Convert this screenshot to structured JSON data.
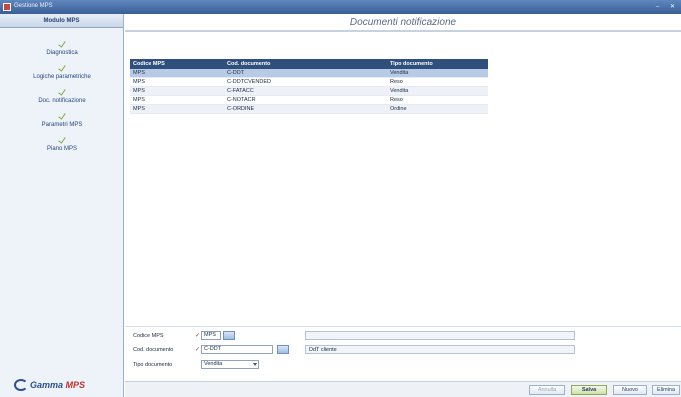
{
  "window": {
    "title": "Gestione MPS",
    "min": "–",
    "close": "✕"
  },
  "sidebar": {
    "header": "Modulo MPS",
    "items": [
      {
        "label": "Diagnostica"
      },
      {
        "label": "Logiche parametriche"
      },
      {
        "label": "Doc. notificazione"
      },
      {
        "label": "Parametri MPS"
      },
      {
        "label": "Piano MPS"
      }
    ],
    "logo": {
      "part1": "Gamma",
      "part2": "MPS"
    }
  },
  "page": {
    "title": "Documenti notificazione"
  },
  "grid": {
    "columns": [
      "Codice MPS",
      "Cod. documento",
      "Tipo documento"
    ],
    "rows": [
      [
        "MPS",
        "C-DDT",
        "Vendita"
      ],
      [
        "MPS",
        "C-DDTCVENDED",
        "Reso"
      ],
      [
        "MPS",
        "C-FATACC",
        "Vendita"
      ],
      [
        "MPS",
        "C-NOTACR",
        "Reso"
      ],
      [
        "MPS",
        "C-ORDINE",
        "Ordine"
      ]
    ]
  },
  "form": {
    "codice_mps_label": "Codice MPS",
    "codice_mps_value": "MPS",
    "cod_documento_label": "Cod. documento",
    "cod_documento_value": "C-DDT",
    "cod_documento_desc": "DdT cliente",
    "tipo_documento_label": "Tipo documento",
    "tipo_documento_value": "Vendita"
  },
  "buttons": {
    "annulla": "Annulla",
    "salva": "Salva",
    "nuovo": "Nuovo",
    "elimina": "Elimina"
  },
  "colors": {
    "grid_header": "#2f4f7d",
    "selected_row": "#b7cbe6",
    "accent_check": "#7ea73a",
    "brand_red": "#c23329"
  },
  "icons": {
    "check": "check-icon",
    "lookup": "lookup-icon",
    "dropdown": "chevron-down-icon"
  }
}
